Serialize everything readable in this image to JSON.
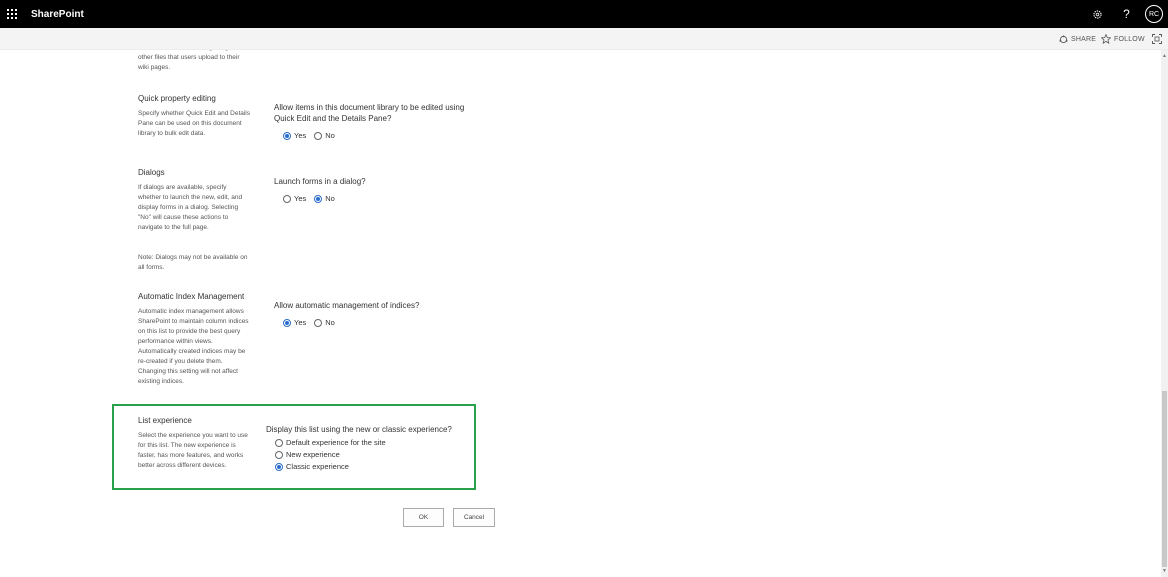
{
  "suite": {
    "app_name": "SharePoint",
    "avatar_initials": "RC"
  },
  "actions": {
    "share": "SHARE",
    "follow": "FOLLOW"
  },
  "sections": {
    "wiki": {
      "desc_partial": "default location for storing images or other files that users upload to their wiki pages."
    },
    "quick_edit": {
      "title": "Quick property editing",
      "desc": "Specify whether Quick Edit and Details Pane can be used on this document library to bulk edit data.",
      "question": "Allow items in this document library to be edited using Quick Edit and the Details Pane?",
      "options": [
        "Yes",
        "No"
      ],
      "selected": "Yes"
    },
    "dialogs": {
      "title": "Dialogs",
      "desc": "If dialogs are available, specify whether to launch the new, edit, and display forms in a dialog. Selecting \"No\" will cause these actions to navigate to the full page.",
      "note": "Note: Dialogs may not be available on all forms.",
      "question": "Launch forms in a dialog?",
      "options": [
        "Yes",
        "No"
      ],
      "selected": "No"
    },
    "index": {
      "title": "Automatic Index Management",
      "desc": "Automatic index management allows SharePoint to maintain column indices on this list to provide the best query performance within views. Automatically created indices may be re-created if you delete them. Changing this setting will not affect existing indices.",
      "question": "Allow automatic management of indices?",
      "options": [
        "Yes",
        "No"
      ],
      "selected": "Yes"
    },
    "list_experience": {
      "title": "List experience",
      "desc": "Select the experience you want to use for this list. The new experience is faster, has more features, and works better across different devices.",
      "question": "Display this list using the new or classic experience?",
      "options": [
        "Default experience for the site",
        "New experience",
        "Classic experience"
      ],
      "selected": "Classic experience"
    }
  },
  "buttons": {
    "ok": "OK",
    "cancel": "Cancel"
  },
  "colors": {
    "suite_bar": "#000000",
    "highlight_border": "#2aa04a",
    "radio_accent": "#2a6dcc"
  },
  "icons": [
    "waffle-icon",
    "gear-icon",
    "help-icon",
    "share-icon",
    "follow-star-icon",
    "focus-mode-icon"
  ]
}
